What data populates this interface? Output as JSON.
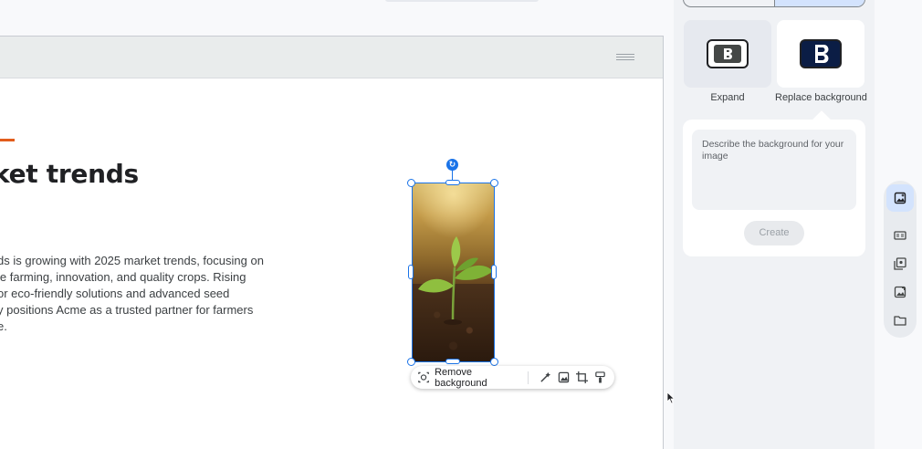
{
  "slide": {
    "title": "ket trends",
    "body_lines": [
      "ds is growing with 2025 market trends, focusing on",
      "le farming, innovation, and quality crops. Rising",
      "or eco-friendly solutions and advanced seed",
      "y positions Acme as a trusted partner for farmers",
      "e."
    ],
    "accent_color": "#e25d1c"
  },
  "image_toolbar": {
    "remove_background_label": "Remove background",
    "icons": [
      "magic-wand-icon",
      "image-settings-icon",
      "crop-icon",
      "format-paint-icon"
    ]
  },
  "side_panel": {
    "modes": [
      {
        "label": "Expand",
        "icon": "expand-image-icon",
        "selected": false
      },
      {
        "label": "Replace background",
        "icon": "replace-background-icon",
        "selected": true
      }
    ],
    "prompt": {
      "placeholder": "Describe the background for your image",
      "create_label": "Create"
    }
  },
  "rail": {
    "icons": [
      "image-generate-icon",
      "text-card-icon",
      "image-gallery-icon",
      "image-edit-icon",
      "folder-icon"
    ],
    "active": 0
  },
  "colors": {
    "selection": "#1a73e8",
    "active_tab": "#d3e3fd"
  }
}
